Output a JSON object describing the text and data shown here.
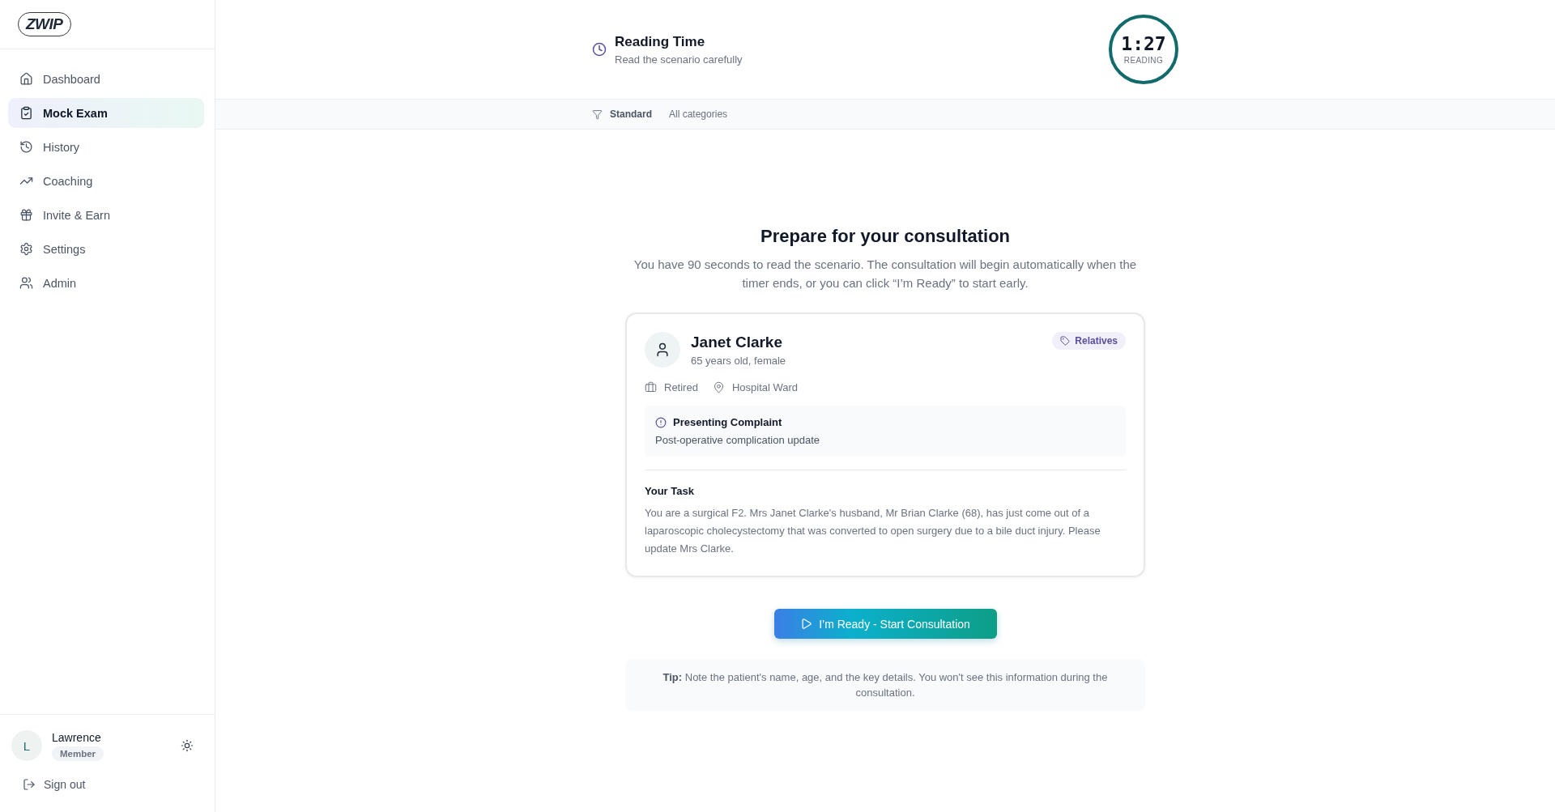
{
  "sidebar": {
    "logo": "ZWIP",
    "nav_items": [
      {
        "label": "Dashboard",
        "selected": false
      },
      {
        "label": "Mock Exam",
        "selected": true
      },
      {
        "label": "History",
        "selected": false
      },
      {
        "label": "Coaching",
        "selected": false
      },
      {
        "label": "Invite & Earn",
        "selected": false
      },
      {
        "label": "Settings",
        "selected": false
      },
      {
        "label": "Admin",
        "selected": false
      }
    ],
    "user": {
      "initial": "L",
      "name": "Lawrence",
      "role": "Member"
    },
    "sign_out": "Sign out"
  },
  "header": {
    "title": "Reading Time",
    "subtitle": "Read the scenario carefully",
    "timer": {
      "time": "1:27",
      "label": "READING"
    }
  },
  "filter_bar": {
    "mode": "Standard",
    "category": "All categories"
  },
  "intro": {
    "title": "Prepare for your consultation",
    "description": "You have 90 seconds to read the scenario. The consultation will begin automatically when the timer ends, or you can click “I’m Ready” to start early."
  },
  "patient_card": {
    "name": "Janet Clarke",
    "details": "65 years old, female",
    "tag": "Relatives",
    "occupation": "Retired",
    "location": "Hospital Ward",
    "complaint": {
      "title": "Presenting Complaint",
      "text": "Post-operative complication update"
    },
    "task": {
      "title": "Your Task",
      "text": "You are a surgical F2. Mrs Janet Clarke's husband, Mr Brian Clarke (68), has just come out of a laparoscopic cholecystectomy that was converted to open surgery due to a bile duct injury. Please update Mrs Clarke."
    }
  },
  "start_button": "I’m Ready - Start Consultation",
  "tip": "**Tip:** Note the patient's name, age, and the key details. You won't see this information during the consultation."
}
